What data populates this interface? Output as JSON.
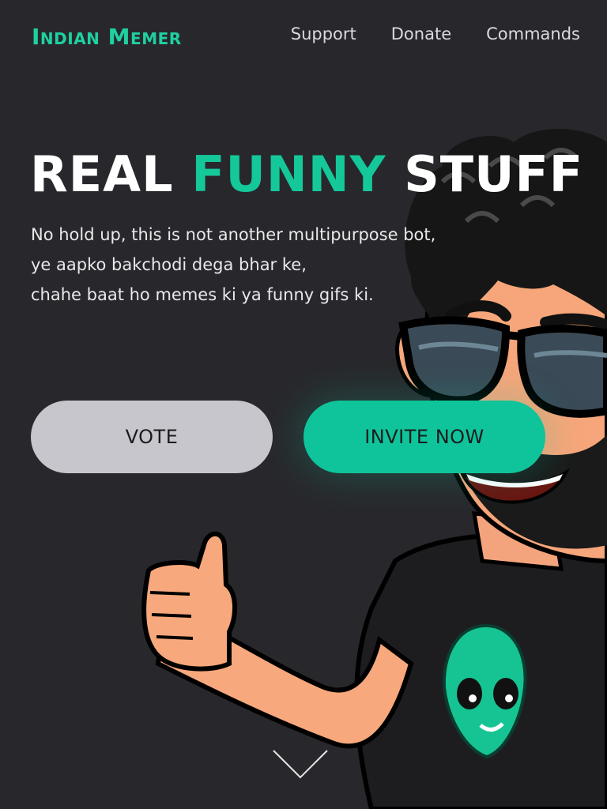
{
  "brand": {
    "name": "Indian Memer"
  },
  "nav": {
    "links": [
      "Support",
      "Donate",
      "Commands"
    ]
  },
  "hero": {
    "headline": {
      "part1": "REAL",
      "part2": "FUNNY",
      "part3": "STUFF"
    },
    "description": [
      "No hold up, this is not another multipurpose bot,",
      "ye aapko bakchodi dega bhar ke,",
      "chahe baat ho memes ki ya funny gifs ki."
    ],
    "buttons": {
      "vote": "VOTE",
      "invite": "INVITE NOW"
    }
  },
  "colors": {
    "background": "#28282c",
    "accent": "#14c89a",
    "vote_button": "#c7c6cc",
    "invite_button": "#0fc49a"
  },
  "icons": {
    "scroll": "chevron-down-icon",
    "character": "cartoon-avatar-illustration"
  }
}
